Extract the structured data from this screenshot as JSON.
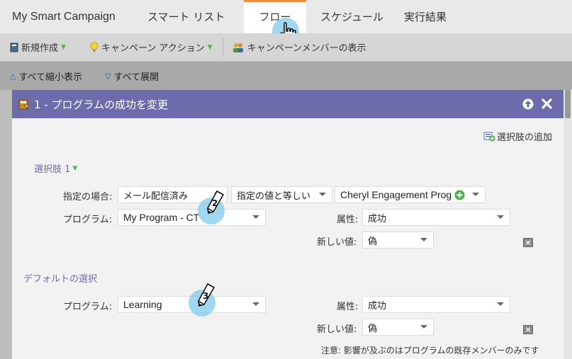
{
  "tabs": [
    {
      "label": "My Smart Campaign"
    },
    {
      "label": "スマート リスト"
    },
    {
      "label": "フロー"
    },
    {
      "label": "スケジュール"
    },
    {
      "label": "実行結果"
    }
  ],
  "toolbar": {
    "new_label": "新規作成",
    "campaign_actions_label": "キャンペーン アクション",
    "view_members_label": "キャンペーンメンバーの表示"
  },
  "subbar": {
    "collapse_all": "すべて縮小表示",
    "expand_all": "すべて展開"
  },
  "step": {
    "title": "1 - プログラムの成功を変更",
    "add_choice": "選択肢の追加",
    "choice1": {
      "heading": "選択肢 1",
      "if_label": "指定の場合:",
      "if_field": "メール配信済み",
      "operator": "指定の値と等しい",
      "value": "Cheryl Engagement Prog",
      "program_label": "プログラム:",
      "program": "My Program - CT",
      "attribute_label": "属性:",
      "attribute": "成功",
      "new_value_label": "新しい値:",
      "new_value": "偽"
    },
    "default_choice": {
      "heading": "デフォルトの選択",
      "program_label": "プログラム:",
      "program": "Learning",
      "attribute_label": "属性:",
      "attribute": "成功",
      "new_value_label": "新しい値:",
      "new_value": "偽"
    },
    "note": "注意: 影響が及ぶのはプログラムの既存メンバーのみです"
  },
  "callouts": [
    "1",
    "2",
    "3"
  ],
  "colors": {
    "accent_tab": "#f38d3c",
    "panel_header": "#6c6bab",
    "callout": "#78c8eb"
  }
}
